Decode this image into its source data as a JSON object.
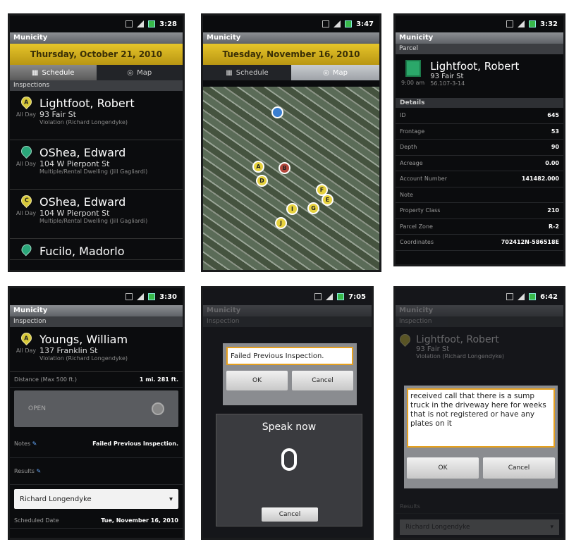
{
  "screen1": {
    "time": "3:28",
    "app": "Municity",
    "date": "Thursday, October 21, 2010",
    "tab_schedule": "Schedule",
    "tab_map": "Map",
    "section": "Inspections",
    "items": [
      {
        "pin": "A",
        "name": "Lightfoot, Robert",
        "addr": "93 Fair St",
        "side": "All Day",
        "sub": "Violation (Richard Longendyke)"
      },
      {
        "pin": "",
        "name": "OShea, Edward",
        "addr": "104 W Pierpont St",
        "side": "All Day",
        "sub": "Multiple/Rental Dwelling (Jill Gagliardi)"
      },
      {
        "pin": "C",
        "name": "OShea, Edward",
        "addr": "104 W Pierpont St",
        "side": "All Day",
        "sub": "Multiple/Rental Dwelling (Jill Gagliardi)"
      },
      {
        "pin": "",
        "name": "Fucilo, Madorlo",
        "addr": "",
        "side": "",
        "sub": ""
      }
    ]
  },
  "screen2": {
    "time": "3:47",
    "app": "Municity",
    "date": "Tuesday, November 16, 2010",
    "tab_schedule": "Schedule",
    "tab_map": "Map",
    "pins": [
      "A",
      "B",
      "D",
      "F",
      "E",
      "G",
      "I",
      "J"
    ]
  },
  "screen3": {
    "time": "3:32",
    "app": "Municity",
    "section": "Parcel",
    "name": "Lightfoot, Robert",
    "addr": "93 Fair St",
    "code": "56.107-3-14",
    "time_label": "9:00 am",
    "details_label": "Details",
    "rows": [
      {
        "k": "ID",
        "v": "645"
      },
      {
        "k": "Frontage",
        "v": "53"
      },
      {
        "k": "Depth",
        "v": "90"
      },
      {
        "k": "Acreage",
        "v": "0.00"
      },
      {
        "k": "Account Number",
        "v": "141482.000"
      },
      {
        "k": "Note",
        "v": ""
      },
      {
        "k": "Property Class",
        "v": "210"
      },
      {
        "k": "Parcel Zone",
        "v": "R-2"
      },
      {
        "k": "Coordinates",
        "v": "702412N-586518E"
      }
    ]
  },
  "screen4": {
    "time": "3:30",
    "app": "Municity",
    "section": "Inspection",
    "pin": "A",
    "name": "Youngs, William",
    "addr": "137 Franklin St",
    "side": "All Day",
    "sub": "Violation (Richard Longendyke)",
    "distance_label": "Distance (Max 500 ft.)",
    "distance_value": "1 mi. 281 ft.",
    "open": "OPEN",
    "notes_label": "Notes",
    "notes_value": "Failed Previous Inspection.",
    "results_label": "Results",
    "inspector": "Richard Longendyke",
    "sched_label": "Scheduled Date",
    "sched_value": "Tue, November 16, 2010"
  },
  "screen5": {
    "time": "7:05",
    "app": "Municity",
    "section": "Inspection",
    "input": "Failed Previous Inspection.",
    "ok": "OK",
    "cancel": "Cancel",
    "speak": "Speak now",
    "cancel2": "Cancel"
  },
  "screen6": {
    "time": "6:42",
    "app": "Municity",
    "section": "Inspection",
    "name": "Lightfoot, Robert",
    "addr": "93 Fair St",
    "sub": "Violation (Richard Longendyke)",
    "text": "received call that there is a sump truck in the driveway here for weeks that is not registered or have any plates on it",
    "ok": "OK",
    "cancel": "Cancel",
    "results_label": "Results",
    "inspector": "Richard Longendyke"
  }
}
